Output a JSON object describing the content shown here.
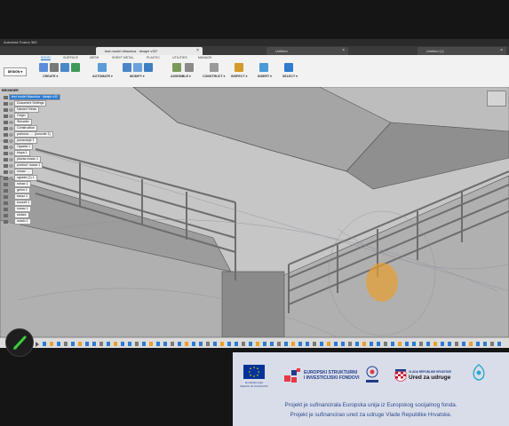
{
  "app": {
    "title": "Autodesk Fusion 360",
    "tabs": [
      {
        "label": "test model čitaonica · dizajni v32*",
        "active": true
      },
      {
        "label": "Untitled",
        "active": false
      },
      {
        "label": "Untitled (1)",
        "active": false
      }
    ]
  },
  "workspace_button": "DESIGN ▾",
  "ribbon": {
    "tabs": [
      "SOLID",
      "SURFACE",
      "MESH",
      "SHEET METAL",
      "PLASTIC",
      "UTILITIES",
      "MANAGE"
    ],
    "active_tab": "SOLID",
    "groups": [
      "CREATE ▾",
      "AUTOMATE ▾",
      "MODIFY ▾",
      "ASSEMBLE ▾",
      "CONSTRUCT ▾",
      "INSPECT ▾",
      "INSERT ▾",
      "SELECT ▾"
    ]
  },
  "browser": {
    "header": "BROWSER",
    "root": "test model čitaonica · dizajni v32",
    "items": [
      "Document Settings",
      "Named Views",
      "Origin",
      "Skica/ke",
      "Construction",
      "pokrova - ... (konzole 1)",
      "ponavanje 1",
      "Ograda 1",
      "klupa 1",
      "plovac nosac 1",
      "pontoni: nosac 1",
      "nosac: ...",
      "ogradd (1) 1",
      "nosac 1",
      "gelon 1",
      "baraz 1",
      "koncelI 1",
      "nosac 1",
      "stolarć",
      "ostalo 1"
    ]
  },
  "colors": {
    "ribbon_active": "#0a6fc2",
    "selection_highlight": "#e8a030",
    "banner_bg": "#d9dde9",
    "banner_text": "#2c4a8f"
  },
  "icons": [
    "pencil-icon",
    "eu-flag-icon",
    "croatia-coat-of-arms-icon"
  ],
  "banner": {
    "logos": {
      "eu_caption": "Europska unija\nZajedno do fondova EU",
      "esif": "EUROPSKI STRUKTURNI\nI INVESTICIJSKI FONDOVI",
      "vlada_small": "VLADA REPUBLIKE HRVATSKE",
      "vlada_big": "Ured za udruge"
    },
    "line1": "Projekt je sufinancirala Europska unija iz Europskog socijalnog fonda.",
    "line2": "Projekt je sufinancirao ured za udruge Vlade Republike Hrvatske."
  }
}
